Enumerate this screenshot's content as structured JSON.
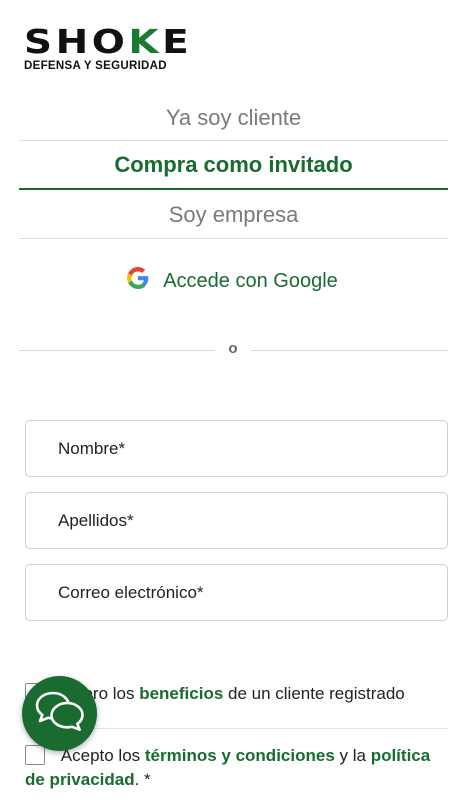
{
  "brand": {
    "logo_text_part1": "SHO",
    "logo_text_part2": "K",
    "logo_text_part3": "E",
    "logo_subtitle": "DEFENSA Y SEGURIDAD",
    "accent_color": "#1a6b30"
  },
  "tabs": [
    {
      "label": "Ya soy cliente",
      "active": false
    },
    {
      "label": "Compra como invitado",
      "active": true
    },
    {
      "label": "Soy empresa",
      "active": false
    }
  ],
  "google_login": {
    "label": "Accede con Google",
    "icon": "google-g-icon"
  },
  "divider_text": "o",
  "form": {
    "nombre": {
      "placeholder": "Nombre*",
      "value": ""
    },
    "apellidos": {
      "placeholder": "Apellidos*",
      "value": ""
    },
    "email": {
      "placeholder": "Correo electrónico*",
      "value": ""
    }
  },
  "benefits_check": {
    "pre": "Quiero los ",
    "link": "beneficios",
    "post": " de un cliente registrado",
    "checked": false
  },
  "terms_check": {
    "pre": " Acepto los ",
    "link1": "términos y condiciones",
    "mid": " y la ",
    "link2": "política de privacidad",
    "post": ". *",
    "checked": false
  },
  "chat_button": {
    "icon": "chat-bubbles-icon"
  }
}
